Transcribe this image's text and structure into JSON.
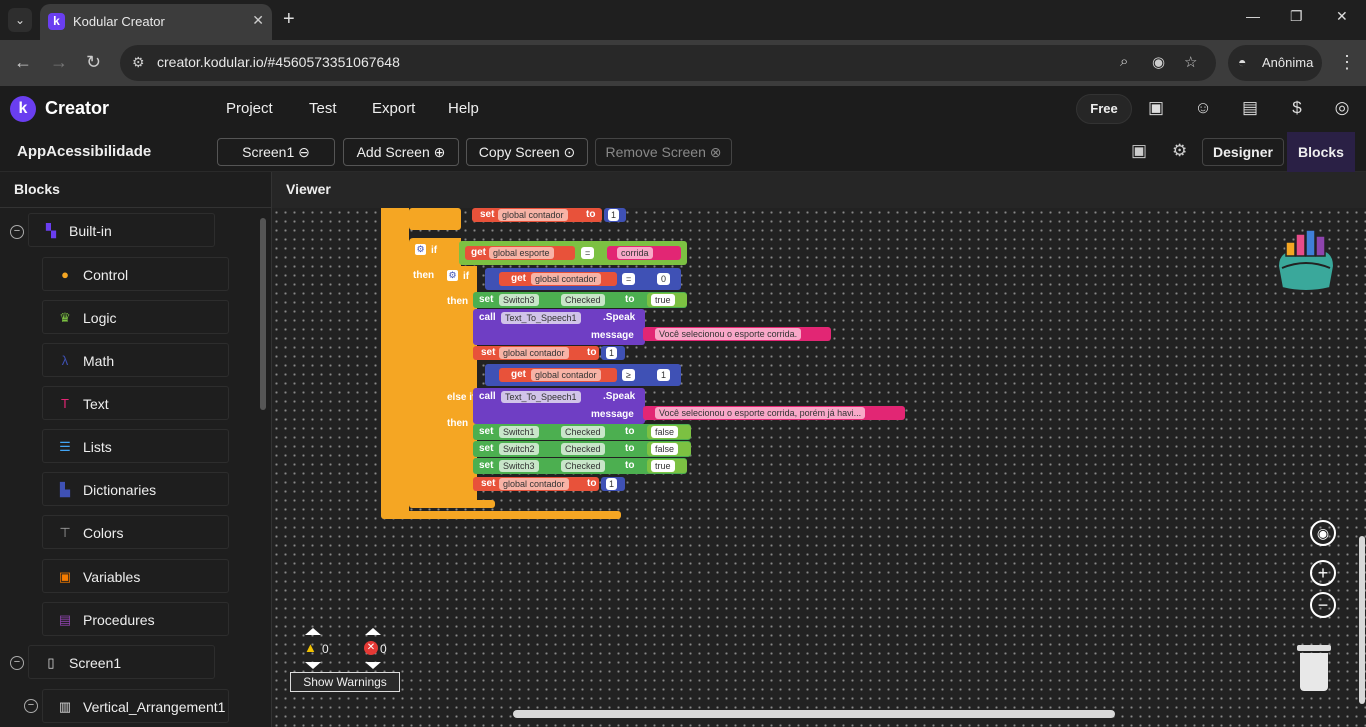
{
  "browser": {
    "tab_title": "Kodular Creator",
    "url": "creator.kodular.io/#4560573351067648",
    "profile_label": "Anônima"
  },
  "app": {
    "brand": "Creator",
    "menu": [
      "Project",
      "Test",
      "Export",
      "Help"
    ],
    "plan_label": "Free"
  },
  "toolbar": {
    "project_name": "AppAcessibilidade",
    "screen_select": "Screen1",
    "add_screen": "Add Screen",
    "copy_screen": "Copy Screen",
    "remove_screen": "Remove Screen",
    "designer": "Designer",
    "blocks": "Blocks"
  },
  "sidebar": {
    "title": "Blocks",
    "builtin": "Built-in",
    "items": [
      {
        "label": "Control",
        "icon": "control-icon",
        "color": "#f5a623"
      },
      {
        "label": "Logic",
        "icon": "logic-icon",
        "color": "#7cc142"
      },
      {
        "label": "Math",
        "icon": "math-icon",
        "color": "#3f51b5"
      },
      {
        "label": "Text",
        "icon": "text-icon",
        "color": "#e22674"
      },
      {
        "label": "Lists",
        "icon": "lists-icon",
        "color": "#42a5f5"
      },
      {
        "label": "Dictionaries",
        "icon": "dictionaries-icon",
        "color": "#3f51b5"
      },
      {
        "label": "Colors",
        "icon": "colors-icon",
        "color": "#9e9e9e"
      },
      {
        "label": "Variables",
        "icon": "variables-icon",
        "color": "#f57c00"
      },
      {
        "label": "Procedures",
        "icon": "procedures-icon",
        "color": "#8e44ad"
      }
    ],
    "screen": "Screen1",
    "child": "Vertical_Arrangement1"
  },
  "viewer": {
    "title": "Viewer",
    "blocks": {
      "set": "set",
      "get": "get",
      "if": "if",
      "then": "then",
      "else_if": "else if",
      "call": "call",
      "to": "to",
      "speak": ".Speak",
      "message": "message",
      "checked": "Checked",
      "global_contador": "global contador",
      "global_esporte": "global esporte",
      "corrida": "corrida",
      "eq": "=",
      "ge": "≥",
      "n0": "0",
      "n1": "1",
      "switch1": "Switch1",
      "switch2": "Switch2",
      "switch3": "Switch3",
      "tts": "Text_To_Speech1",
      "true": "true",
      "false": "false",
      "msg1": "Você selecionou o esporte corrida.",
      "msg2": "Você selecionou o esporte corrida, porém já havi..."
    },
    "warnings_count": "0",
    "errors_count": "0",
    "show_warnings": "Show Warnings"
  }
}
